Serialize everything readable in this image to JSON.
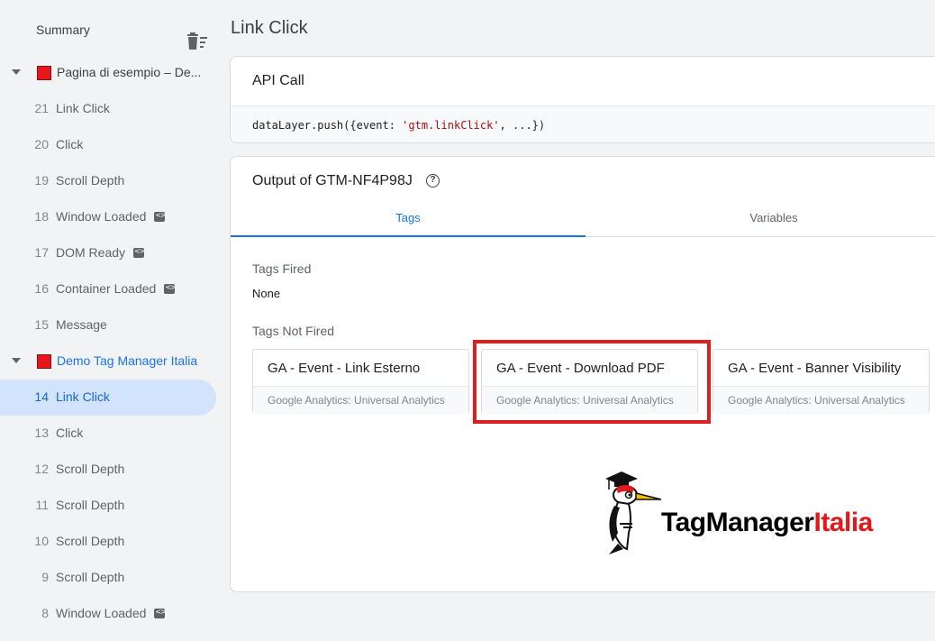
{
  "sidebar": {
    "summary_label": "Summary",
    "pages": [
      {
        "title": "Pagina di esempio – De...",
        "events": [
          {
            "num": "21",
            "label": "Link Click",
            "code": false
          },
          {
            "num": "20",
            "label": "Click",
            "code": false
          },
          {
            "num": "19",
            "label": "Scroll Depth",
            "code": false
          },
          {
            "num": "18",
            "label": "Window Loaded",
            "code": true
          },
          {
            "num": "17",
            "label": "DOM Ready",
            "code": true
          },
          {
            "num": "16",
            "label": "Container Loaded",
            "code": true
          },
          {
            "num": "15",
            "label": "Message",
            "code": false
          }
        ]
      },
      {
        "title": "Demo Tag Manager Italia",
        "events": [
          {
            "num": "14",
            "label": "Link Click",
            "code": false,
            "selected": true
          },
          {
            "num": "13",
            "label": "Click",
            "code": false
          },
          {
            "num": "12",
            "label": "Scroll Depth",
            "code": false
          },
          {
            "num": "11",
            "label": "Scroll Depth",
            "code": false
          },
          {
            "num": "10",
            "label": "Scroll Depth",
            "code": false
          },
          {
            "num": "9",
            "label": "Scroll Depth",
            "code": false
          },
          {
            "num": "8",
            "label": "Window Loaded",
            "code": true
          }
        ]
      }
    ]
  },
  "main": {
    "title": "Link Click",
    "api_call": {
      "title": "API Call",
      "code_prefix": "dataLayer.push({event: ",
      "code_string": "'gtm.linkClick'",
      "code_suffix": ", ...})"
    },
    "output": {
      "title": "Output of GTM-NF4P98J",
      "tabs": [
        "Tags",
        "Variables"
      ],
      "active_tab": "Tags",
      "tags_fired_label": "Tags Fired",
      "tags_fired_value": "None",
      "tags_not_fired_label": "Tags Not Fired",
      "tags_not_fired": [
        {
          "name": "GA - Event - Link Esterno",
          "type": "Google Analytics: Universal Analytics"
        },
        {
          "name": "GA - Event - Download PDF",
          "type": "Google Analytics: Universal Analytics"
        },
        {
          "name": "GA - Event - Banner Visibility",
          "type": "Google Analytics: Universal Analytics"
        }
      ]
    }
  },
  "logo": {
    "part1": "TagManager",
    "part2": "Italia"
  },
  "colors": {
    "accent": "#1a73e8",
    "selected_bg": "#d2e3fc",
    "highlight": "#e01e1e",
    "page_icon": "#e6171a"
  }
}
